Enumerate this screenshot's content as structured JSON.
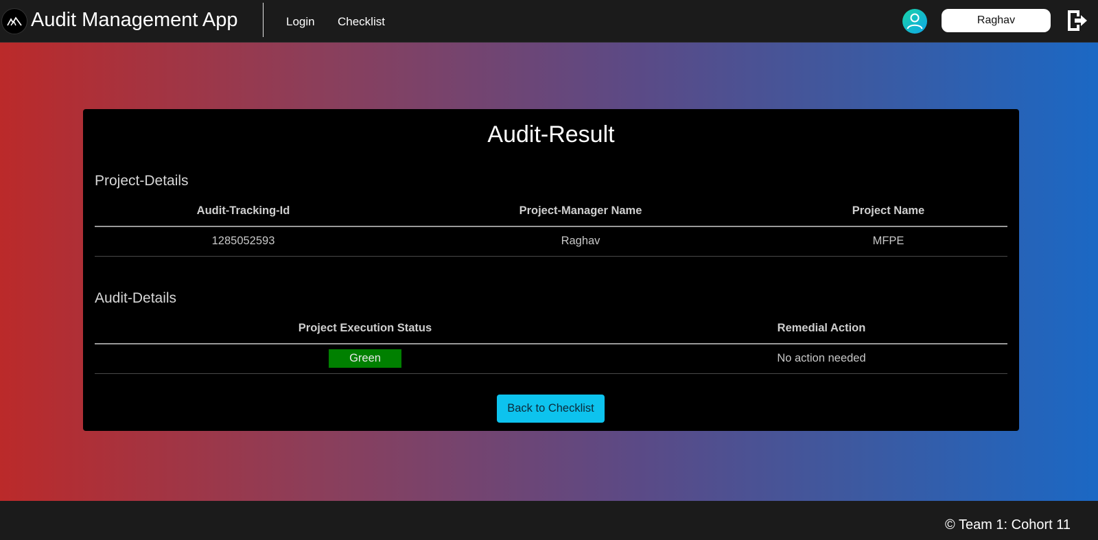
{
  "navbar": {
    "app_title": "Audit Management App",
    "links": [
      "Login",
      "Checklist"
    ],
    "user_name": "Raghav",
    "icons": {
      "logo": "mountain-logo-icon",
      "avatar": "user-avatar-icon",
      "logout": "logout-icon"
    }
  },
  "card": {
    "title": "Audit-Result",
    "project_section": {
      "heading": "Project-Details",
      "columns": [
        "Audit-Tracking-Id",
        "Project-Manager Name",
        "Project Name"
      ],
      "row": [
        "1285052593",
        "Raghav",
        "MFPE"
      ]
    },
    "audit_section": {
      "heading": "Audit-Details",
      "columns": [
        "Project Execution Status",
        "Remedial Action"
      ],
      "row": {
        "status": "Green",
        "action": "No action needed"
      }
    },
    "back_button_label": "Back to Checklist"
  },
  "footer": {
    "text": "© Team 1: Cohort 11"
  },
  "colors": {
    "accent": "#0dc3ee",
    "status_green": "#008000",
    "gradient_left": "#bb2a2a",
    "gradient_right": "#1b68c4",
    "navbar_bg": "#1b1b1b"
  }
}
